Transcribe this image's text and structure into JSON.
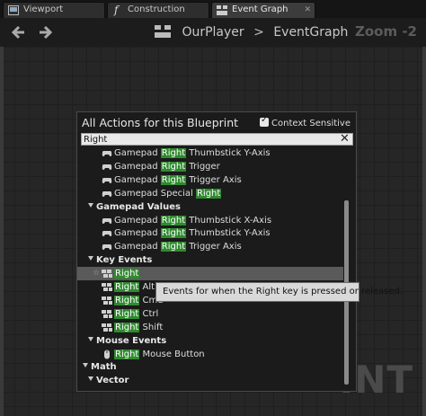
{
  "tabs": [
    {
      "label": "Viewport",
      "icon": "viewport-icon"
    },
    {
      "label": "Construction Script",
      "icon": "function-icon"
    },
    {
      "label": "Event Graph",
      "icon": "event-graph-icon"
    }
  ],
  "toolbar": {
    "breadcrumb_blueprint": "OurPlayer",
    "breadcrumb_separator": ">",
    "breadcrumb_graph": "EventGraph"
  },
  "zoom_label": "Zoom -2",
  "watermark": "INT",
  "popup": {
    "title": "All Actions for this Blueprint",
    "context_sensitive_label": "Context Sensitive",
    "context_sensitive_checked": true,
    "search_value": "Right",
    "clear_glyph": "✕"
  },
  "rows": [
    {
      "kind": "item",
      "pre": "Gamepad ",
      "hl": "Right",
      "post": " Thumbstick Y-Axis",
      "icon": "gamepad-icon"
    },
    {
      "kind": "item",
      "pre": "Gamepad ",
      "hl": "Right",
      "post": " Trigger",
      "icon": "gamepad-icon"
    },
    {
      "kind": "item",
      "pre": "Gamepad ",
      "hl": "Right",
      "post": " Trigger Axis",
      "icon": "gamepad-icon"
    },
    {
      "kind": "item",
      "pre": "Gamepad Special ",
      "hl": "Right",
      "post": "",
      "icon": "gamepad-icon"
    },
    {
      "kind": "header",
      "label": "Gamepad Values"
    },
    {
      "kind": "item",
      "pre": "Gamepad ",
      "hl": "Right",
      "post": " Thumbstick X-Axis",
      "icon": "gamepad-icon"
    },
    {
      "kind": "item",
      "pre": "Gamepad ",
      "hl": "Right",
      "post": " Thumbstick Y-Axis",
      "icon": "gamepad-icon"
    },
    {
      "kind": "item",
      "pre": "Gamepad ",
      "hl": "Right",
      "post": " Trigger Axis",
      "icon": "gamepad-icon"
    },
    {
      "kind": "header",
      "label": "Key Events"
    },
    {
      "kind": "item",
      "pre": "",
      "hl": "Right",
      "post": "",
      "icon": "keyboard-icon",
      "selected": true
    },
    {
      "kind": "item",
      "pre": "",
      "hl": "Right",
      "post": " Alt",
      "icon": "keyboard-icon"
    },
    {
      "kind": "item",
      "pre": "",
      "hl": "Right",
      "post": " Cmd",
      "icon": "keyboard-icon"
    },
    {
      "kind": "item",
      "pre": "",
      "hl": "Right",
      "post": " Ctrl",
      "icon": "keyboard-icon"
    },
    {
      "kind": "item",
      "pre": "",
      "hl": "Right",
      "post": " Shift",
      "icon": "keyboard-icon"
    },
    {
      "kind": "header",
      "label": "Mouse Events"
    },
    {
      "kind": "item",
      "pre": "",
      "hl": "Right",
      "post": " Mouse Button",
      "icon": "mouse-icon"
    },
    {
      "kind": "header",
      "label": "Math",
      "level": 0
    },
    {
      "kind": "header",
      "label": "Vector"
    }
  ],
  "tooltip": "Events for when the Right key is pressed or released.",
  "colors": {
    "highlight": "#2f8a2f",
    "background": "#262626",
    "popup": "#1b1b1b"
  }
}
